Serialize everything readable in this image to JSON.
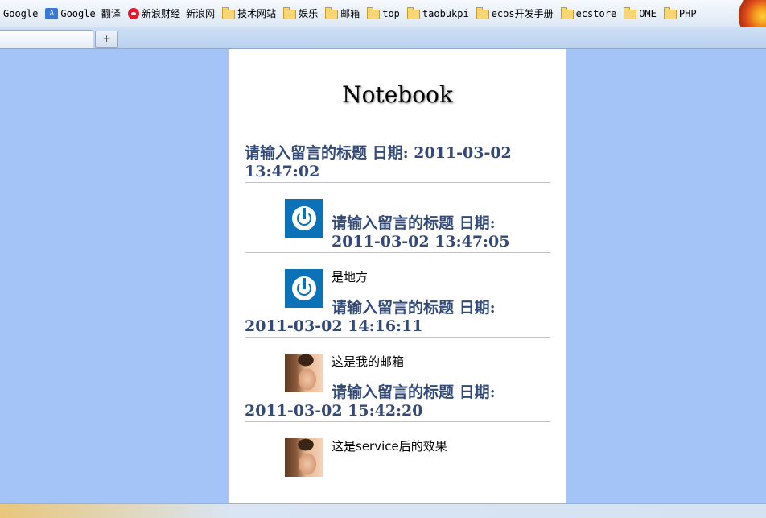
{
  "bookmarks": [
    {
      "label": "Google",
      "icon": "none"
    },
    {
      "label": "Google 翻译",
      "icon": "google-translate-icon"
    },
    {
      "label": "新浪财经_新浪网",
      "icon": "weibo-icon"
    },
    {
      "label": "技术网站",
      "icon": "folder-icon"
    },
    {
      "label": "娱乐",
      "icon": "folder-icon"
    },
    {
      "label": "邮箱",
      "icon": "folder-icon"
    },
    {
      "label": "top",
      "icon": "folder-icon"
    },
    {
      "label": "taobukpi",
      "icon": "folder-icon"
    },
    {
      "label": "ecos开发手册",
      "icon": "folder-icon"
    },
    {
      "label": "ecstore",
      "icon": "folder-icon"
    },
    {
      "label": "OME",
      "icon": "folder-icon"
    },
    {
      "label": "PHP",
      "icon": "folder-icon"
    }
  ],
  "tabs": {
    "new_tab_label": "+"
  },
  "notebook": {
    "title": "Notebook",
    "entries": [
      {
        "heading": "请输入留言的标题 日期: 2011-03-02 13:47:02",
        "message": "",
        "avatar": "power-icon"
      },
      {
        "heading": "请输入留言的标题 日期: 2011-03-02 13:47:05",
        "message": "是地方",
        "avatar": "power-icon"
      },
      {
        "heading": "请输入留言的标题 日期: 2011-03-02 14:16:11",
        "message": "这是我的邮箱",
        "avatar": "photo"
      },
      {
        "heading": "请输入留言的标题 日期: 2011-03-02 15:42:20",
        "message": "这是service后的效果",
        "avatar": "photo"
      }
    ]
  },
  "colors": {
    "background": "#a4c4f8",
    "heading": "#334a78",
    "avatar_blue": "#0c72b8"
  }
}
